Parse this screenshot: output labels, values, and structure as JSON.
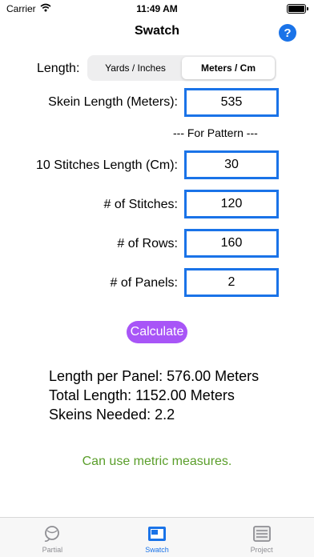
{
  "status_bar": {
    "carrier": "Carrier",
    "time": "11:49 AM"
  },
  "nav": {
    "title": "Swatch",
    "help_label": "?"
  },
  "length": {
    "label": "Length:",
    "options": [
      "Yards / Inches",
      "Meters / Cm"
    ],
    "selected": "Meters / Cm"
  },
  "skein": {
    "label": "Skein Length (Meters):",
    "value": "535"
  },
  "pattern_header": "--- For Pattern ---",
  "stitches_length": {
    "label": "10 Stitches Length (Cm):",
    "value": "30"
  },
  "stitches": {
    "label": "# of Stitches:",
    "value": "120"
  },
  "rows": {
    "label": "# of Rows:",
    "value": "160"
  },
  "panels": {
    "label": "# of Panels:",
    "value": "2"
  },
  "calculate_label": "Calculate",
  "results": {
    "length_per_panel": "Length per Panel: 576.00 Meters",
    "total_length": "Total Length: 1152.00 Meters",
    "skeins_needed": "Skeins Needed: 2.2"
  },
  "note": "Can use metric measures.",
  "tabs": [
    {
      "label": "Partial",
      "icon": "yarn-icon",
      "active": false
    },
    {
      "label": "Swatch",
      "icon": "swatch-icon",
      "active": true
    },
    {
      "label": "Project",
      "icon": "project-icon",
      "active": false
    }
  ],
  "colors": {
    "accent": "#1a73e8",
    "button": "#a855f7",
    "note": "#5a9e2a"
  }
}
